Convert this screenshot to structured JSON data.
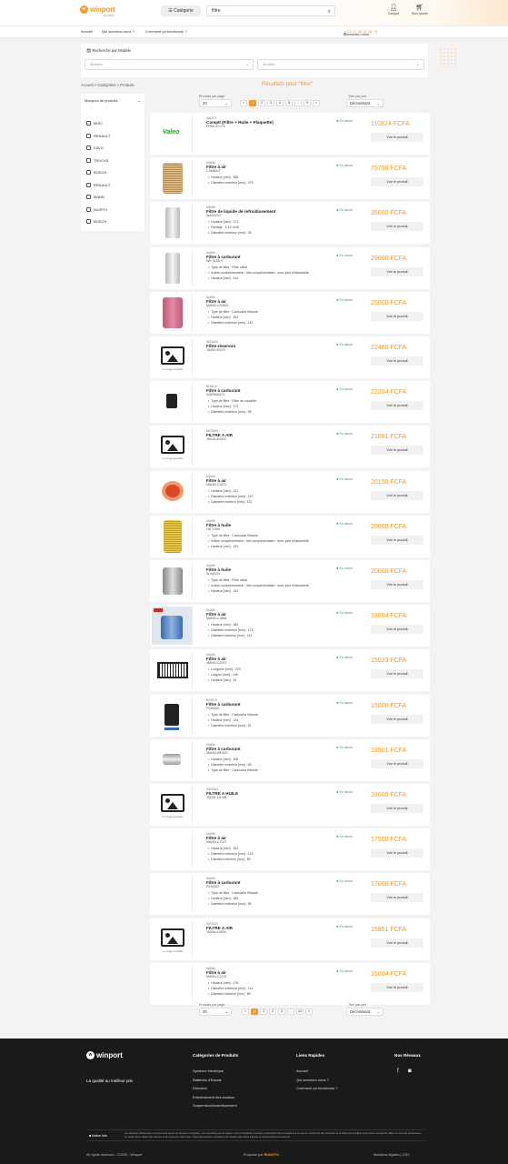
{
  "header": {
    "logo_text": "winport",
    "logo_sub": "by cfao",
    "category_button": "Catégorie",
    "search_value": "filtre",
    "account_label": "Compte",
    "cart_label": "Mon panier"
  },
  "nav": {
    "items": [
      "Accueil",
      "Qui sommes-nous ?",
      "Comment ça fonctionne ?"
    ],
    "contact_label": "Contactez-nous :",
    "contact_phone": "+225 07 48 13 38 73"
  },
  "vehicle_search": {
    "label": "Recherche par Modèle",
    "brand_placeholder": "Marque",
    "model_placeholder": "Modèle"
  },
  "breadcrumb": "Accueil  >  Catégories  >  Produits",
  "results_title": "Résultats pour \"filtre\"",
  "sidebar": {
    "title": "Marques de produits",
    "brands": [
      "MISC",
      "RENAULT",
      "KAVO",
      "TRUCKS",
      "BOSCH",
      "RENAULT",
      "MANN",
      "WURTH",
      "BOSCH"
    ]
  },
  "controls": {
    "per_page_label": "Produits par page",
    "per_page_value": "20",
    "sort_label": "Trier par prix",
    "sort_value": "Décroissant",
    "pages": [
      "<",
      "1",
      "2",
      "3",
      "4",
      "5",
      "...",
      "9",
      ">"
    ],
    "bottom_pages": [
      "<",
      "1",
      "2",
      "3",
      "4",
      "...",
      "14",
      ">"
    ]
  },
  "products": [
    {
      "brand": "VALEO",
      "title": "Comptl (Filtre + Huile + Plaquette)",
      "ref": "PRMI-ZGJ70",
      "features": [],
      "stock": "En stock",
      "price": "110824 FCFA",
      "image": "valeo-logo"
    },
    {
      "brand": "MANN",
      "title": "Filtre à air",
      "ref": "C25860/7",
      "features": [
        "Hauteur [mm] : 368",
        "Diamètre extérieur [mm] : 275"
      ],
      "stock": "En stock",
      "price": "75758 FCFA",
      "image": "cylinder-filter"
    },
    {
      "brand": "MANN",
      "title": "Filtre de liquide de refroidissement",
      "ref": "WA9423/7",
      "features": [
        "Hauteur [mm] : 171",
        "Filetage : 1-14 UNS",
        "Diamètre extérieur [mm] : 93"
      ],
      "stock": "En stock",
      "price": "35000 FCFA",
      "image": "white-filter"
    },
    {
      "brand": "MANN",
      "title": "Filtre à carburant",
      "ref": "WK 9165 X",
      "features": [
        "Type de filtre : Filtre vissé",
        "Article complémentaire / Info complémentaire : avec joint d'étanchéité",
        "Hauteur [mm] : 212"
      ],
      "stock": "En stock",
      "price": "29000 FCFA",
      "image": "white-filter"
    },
    {
      "brand": "MANN",
      "title": "Filtre à air",
      "ref": "MANN-C20500",
      "features": [
        "Type de filtre : Cartouche filtrante",
        "Hauteur [mm] : 262",
        "Diamètre extérieur [mm] : 187"
      ],
      "stock": "En stock",
      "price": "25000 FCFA",
      "image": "pink-filter"
    },
    {
      "brand": "NISSAN",
      "title": "Filtre-réservoir",
      "ref": "16400-9W70",
      "features": [],
      "stock": "En stock",
      "price": "22460 FCFA",
      "image": "noimg"
    },
    {
      "brand": "BOSCH",
      "title": "Filtre à carburant",
      "ref": "0450906374",
      "features": [
        "Type de filtre : Filtre de conduite",
        "Hauteur [mm] : 172",
        "Diamètre extérieur [mm] : 85"
      ],
      "stock": "En stock",
      "price": "22204 FCFA",
      "image": "small-part"
    },
    {
      "brand": "NISSAN",
      "title": "FILTRE A AIR",
      "ref": "16546-8H300",
      "features": [],
      "stock": "En stock",
      "price": "21081 FCFA",
      "image": "noimg"
    },
    {
      "brand": "MANN",
      "title": "Filtre à air",
      "ref": "MANN-C1571",
      "features": [
        "Hauteur [mm] : 121",
        "Diamètre extérieur [mm] : 157",
        "Diamètre intérieur [mm] : 101"
      ],
      "stock": "En stock",
      "price": "20150 FCFA",
      "image": "red-filter"
    },
    {
      "brand": "MANN",
      "title": "Filtre à huile",
      "ref": "HU 719/6",
      "features": [
        "Type de filtre : Cartouche filtrante",
        "Article complémentaire / Info complémentaire : avec joint d'étanchéité",
        "Hauteur [mm] : 133"
      ],
      "stock": "En stock",
      "price": "20000 FCFA",
      "image": "yellow-filter"
    },
    {
      "brand": "MANN",
      "title": "Filtre à huile",
      "ref": "W 940/25",
      "features": [
        "Type de filtre : Filtre vissé",
        "Article complémentaire / Info complémentaire : avec joint d'étanchéité",
        "Hauteur [mm] : 142"
      ],
      "stock": "En stock",
      "price": "20000 FCFA",
      "image": "grey-filter"
    },
    {
      "brand": "MANN",
      "title": "Filtre à air",
      "ref": "MANN-C1868",
      "features": [
        "Hauteur [mm] : 182",
        "Diamètre extérieur [mm] : 175",
        "Diamètre intérieur [mm] : 112"
      ],
      "stock": "En stock",
      "price": "18694 FCFA",
      "image": "boxed-filter"
    },
    {
      "brand": "MANN",
      "title": "Filtre à air",
      "ref": "MANN-C2297",
      "features": [
        "Longueur [mm] : 229",
        "Largeur [mm] : 196",
        "Hauteur [mm] : 42"
      ],
      "stock": "En stock",
      "price": "15023 FCFA",
      "image": "panel-filter"
    },
    {
      "brand": "BOSCH",
      "title": "Filtre à carburant",
      "ref": "F026402",
      "features": [
        "Type de filtre : Cartouche filtrante",
        "Hauteur [mm] : 124",
        "Diamètre extérieur [mm] : 81"
      ],
      "stock": "En stock",
      "price": "15000 FCFA",
      "image": "fuel-filter"
    },
    {
      "brand": "MANN",
      "title": "Filtre à carburant",
      "ref": "MANN-WK820",
      "features": [
        "Hauteur [mm] : 108",
        "Diamètre extérieur [mm] : 63",
        "Type de filtre : Cartouche filtrante"
      ],
      "stock": "En stock",
      "price": "18501 FCFA",
      "image": "inline-filter"
    },
    {
      "brand": "NISSAN",
      "title": "FILTRE A HUILE",
      "ref": "15208-31U0B",
      "features": [],
      "stock": "En stock",
      "price": "18000 FCFA",
      "image": "noimg"
    },
    {
      "brand": "MANN",
      "title": "Filtre à air",
      "ref": "MANN-C1337",
      "features": [
        "Hauteur [mm] : 152",
        "Diamètre extérieur [mm] : 132",
        "Diamètre intérieur [mm] : 80"
      ],
      "stock": "En stock",
      "price": "17500 FCFA",
      "image": "blank"
    },
    {
      "brand": "MANN",
      "title": "Filtre à carburant",
      "ref": "F026402",
      "features": [
        "Type de filtre : Cartouche filtrante",
        "Hauteur [mm] : 180",
        "Diamètre extérieur [mm] : 80"
      ],
      "stock": "En stock",
      "price": "17000 FCFA",
      "image": "blank"
    },
    {
      "brand": "NISSAN",
      "title": "FILTRE A AIR",
      "ref": "16546-4JA0A",
      "features": [],
      "stock": "En stock",
      "price": "15851 FCFA",
      "image": "noimg"
    },
    {
      "brand": "MANN",
      "title": "Filtre à air",
      "ref": "MANN-C1176",
      "features": [
        "Hauteur [mm] : 176",
        "Diamètre extérieur [mm] : 114",
        "Diamètre intérieur [mm] : 65"
      ],
      "stock": "En stock",
      "price": "15004 FCFA",
      "image": "blank"
    }
  ],
  "labels": {
    "view_product": "Voir le produit",
    "no_image": "no image available"
  },
  "footer": {
    "logo_text": "winport",
    "tagline": "La qualité au meilleur prix",
    "categories_title": "Catégories de Produits",
    "categories": [
      "Système électrique",
      "Batteries d'Essais",
      "Direction",
      "Entraînement des essieux",
      "Suspension/Amortissement"
    ],
    "quick_links_title": "Liens Rapides",
    "quick_links": [
      "Accueil",
      "Qui sommes-nous ?",
      "Comment ça fonctionne ?"
    ],
    "social_title": "Nos Réseaux",
    "notice_label": "Notice Info",
    "notice_text": "Les données référencées ci-contre sont issues de données compilées, non couvertes par les règles. Il est conseillé de procéder à vérification des données et à la mise en conformité des données de la référence d'origine avant toute commande. Elles ne sont pas exhaustives, en raison de la nature des sources et du temps de mise à jour. Toute reproduction constitue une violation des droits d'auteur et est formellement proscrite.",
    "copyright": "All rights reserved - ©2025 - Winport",
    "powered_label": "Propulsé par",
    "powered_brand": "RUNOTO",
    "legal": "Mentions légales  |  CGV"
  }
}
